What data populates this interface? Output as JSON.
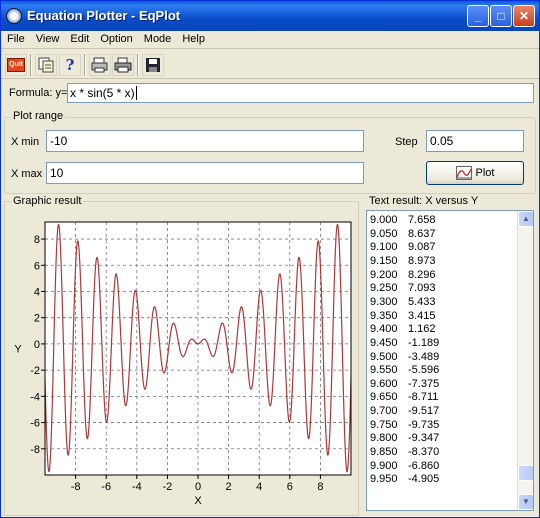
{
  "window": {
    "title": "Equation Plotter - EqPlot"
  },
  "menu": [
    "File",
    "View",
    "Edit",
    "Option",
    "Mode",
    "Help"
  ],
  "toolbar": {
    "quit_label": "Quit",
    "help_label": "?"
  },
  "formula": {
    "label": "Formula: y=",
    "value": "x * sin(5 * x)"
  },
  "plot_range": {
    "title": "Plot range",
    "xmin_label": "X min",
    "xmin_value": "-10",
    "xmax_label": "X max",
    "xmax_value": "10",
    "step_label": "Step",
    "step_value": "0.05",
    "plot_button": "Plot"
  },
  "graphic": {
    "title": "Graphic result"
  },
  "text_result": {
    "title": "Text result: X versus Y",
    "rows": [
      {
        "x": "9.000",
        "y": "7.658"
      },
      {
        "x": "9.050",
        "y": "8.637"
      },
      {
        "x": "9.100",
        "y": "9.087"
      },
      {
        "x": "9.150",
        "y": "8.973"
      },
      {
        "x": "9.200",
        "y": "8.296"
      },
      {
        "x": "9.250",
        "y": "7.093"
      },
      {
        "x": "9.300",
        "y": "5.433"
      },
      {
        "x": "9.350",
        "y": "3.415"
      },
      {
        "x": "9.400",
        "y": "1.162"
      },
      {
        "x": "9.450",
        "y": "-1.189"
      },
      {
        "x": "9.500",
        "y": "-3.489"
      },
      {
        "x": "9.550",
        "y": "-5.596"
      },
      {
        "x": "9.600",
        "y": "-7.375"
      },
      {
        "x": "9.650",
        "y": "-8.711"
      },
      {
        "x": "9.700",
        "y": "-9.517"
      },
      {
        "x": "9.750",
        "y": "-9.735"
      },
      {
        "x": "9.800",
        "y": "-9.347"
      },
      {
        "x": "9.850",
        "y": "-8.370"
      },
      {
        "x": "9.900",
        "y": "-6.860"
      },
      {
        "x": "9.950",
        "y": "-4.905"
      }
    ]
  },
  "chart_data": {
    "type": "line",
    "function": "x * sin(5 * x)",
    "xlabel": "X",
    "ylabel": "Y",
    "xlim": [
      -10,
      10
    ],
    "ylim": [
      -10,
      9.3
    ],
    "xticks": [
      -8,
      -6,
      -4,
      -2,
      0,
      2,
      4,
      6,
      8
    ],
    "yticks": [
      -8,
      -6,
      -4,
      -2,
      0,
      2,
      4,
      6,
      8
    ],
    "x_start": -10,
    "x_end": 10,
    "x_step": 0.05,
    "grid": true,
    "line_color": "#a83a3a"
  }
}
